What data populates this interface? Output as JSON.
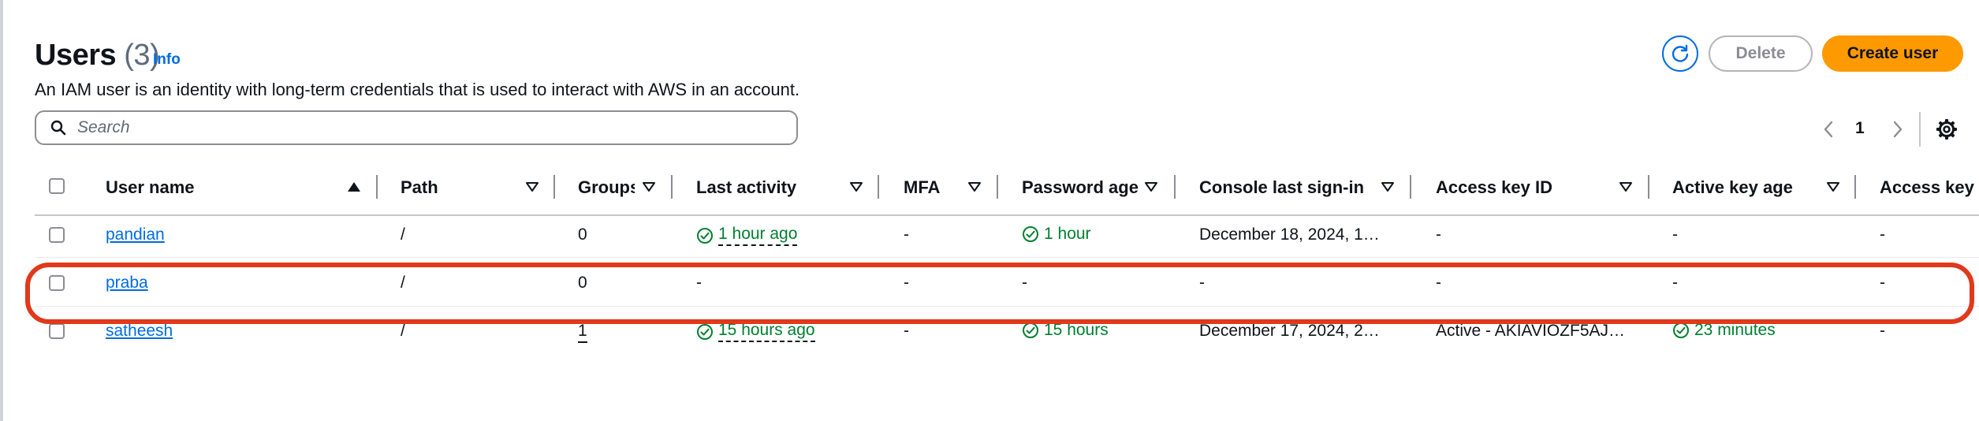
{
  "header": {
    "title": "Users",
    "count": "(3)",
    "info_label": "Info",
    "description": "An IAM user is an identity with long-term credentials that is used to interact with AWS in an account."
  },
  "search": {
    "placeholder": "Search",
    "value": ""
  },
  "toolbar": {
    "refresh_icon": "refresh-icon",
    "delete_label": "Delete",
    "create_label": "Create user"
  },
  "pagination": {
    "current_page": "1"
  },
  "columns": [
    {
      "label": "User name"
    },
    {
      "label": "Path"
    },
    {
      "label": "Groups"
    },
    {
      "label": "Last activity"
    },
    {
      "label": "MFA"
    },
    {
      "label": "Password age"
    },
    {
      "label": "Console last sign-in"
    },
    {
      "label": "Access key ID"
    },
    {
      "label": "Active key age"
    },
    {
      "label": "Access key"
    }
  ],
  "rows": [
    {
      "user_name": "pandian",
      "path": "/",
      "groups": "0",
      "last_activity": "1 hour ago",
      "mfa": "-",
      "password_age": "1 hour",
      "console_last_signin": "December 18, 2024, 1…",
      "access_key_id": "-",
      "active_key_age": "-",
      "access_key": "-"
    },
    {
      "user_name": "praba",
      "path": "/",
      "groups": "0",
      "last_activity": "-",
      "mfa": "-",
      "password_age": "-",
      "console_last_signin": "-",
      "access_key_id": "-",
      "active_key_age": "-",
      "access_key": "-"
    },
    {
      "user_name": "satheesh",
      "path": "/",
      "groups": "1",
      "last_activity": "15 hours ago",
      "mfa": "-",
      "password_age": "15 hours",
      "console_last_signin": "December 17, 2024, 2…",
      "access_key_id": "Active - AKIAVIOZF5AJ…",
      "active_key_age": "23 minutes",
      "access_key": "-"
    }
  ],
  "colors": {
    "link": "#006ce0",
    "accent": "#ff9900",
    "success": "#00802f",
    "highlight": "#e0391b"
  }
}
